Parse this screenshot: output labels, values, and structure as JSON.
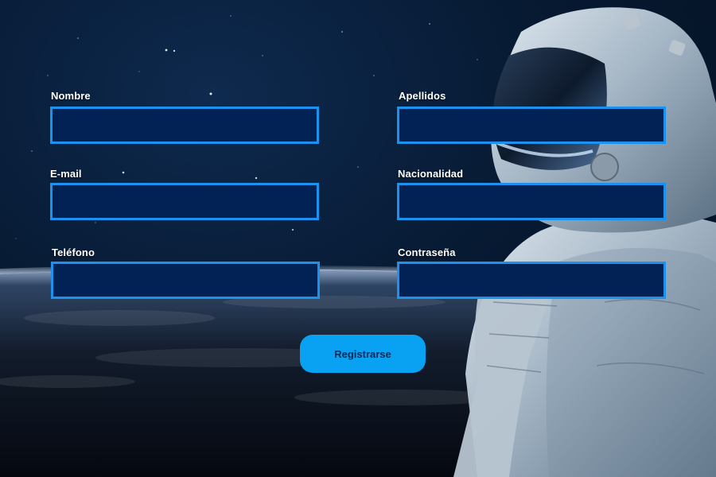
{
  "form": {
    "fields": [
      {
        "id": "nombre",
        "label": "Nombre",
        "value": "",
        "placeholder": ""
      },
      {
        "id": "apellidos",
        "label": "Apellidos",
        "value": "",
        "placeholder": ""
      },
      {
        "id": "email",
        "label": "E-mail",
        "value": "",
        "placeholder": ""
      },
      {
        "id": "nacionalidad",
        "label": "Nacionalidad",
        "value": "",
        "placeholder": ""
      },
      {
        "id": "telefono",
        "label": "Teléfono",
        "value": "",
        "placeholder": ""
      },
      {
        "id": "contrasena",
        "label": "Contraseña",
        "value": "",
        "placeholder": ""
      }
    ],
    "submit_label": "Registrarse"
  },
  "colors": {
    "input_background": "#022154",
    "input_border": "#1a92ee",
    "button_background": "#09a1f2",
    "button_text": "#0b2a55",
    "label_text": "#ffffff"
  },
  "background": {
    "scene": "space-astronaut-earth-horizon"
  }
}
